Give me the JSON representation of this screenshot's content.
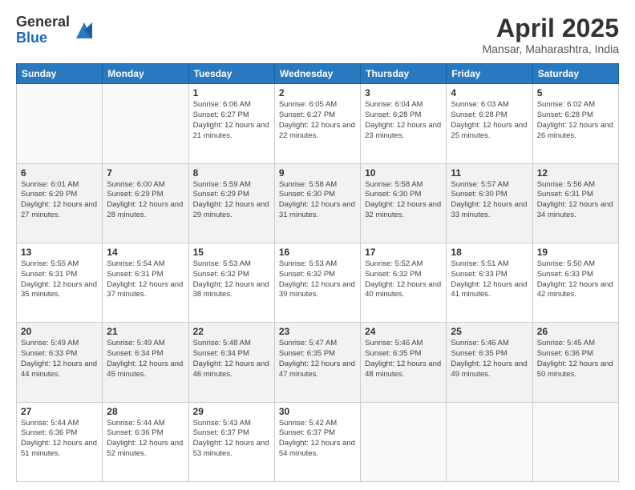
{
  "logo": {
    "general": "General",
    "blue": "Blue"
  },
  "title": "April 2025",
  "location": "Mansar, Maharashtra, India",
  "weekdays": [
    "Sunday",
    "Monday",
    "Tuesday",
    "Wednesday",
    "Thursday",
    "Friday",
    "Saturday"
  ],
  "weeks": [
    [
      {
        "day": "",
        "sunrise": "",
        "sunset": "",
        "daylight": ""
      },
      {
        "day": "",
        "sunrise": "",
        "sunset": "",
        "daylight": ""
      },
      {
        "day": "1",
        "sunrise": "Sunrise: 6:06 AM",
        "sunset": "Sunset: 6:27 PM",
        "daylight": "Daylight: 12 hours and 21 minutes."
      },
      {
        "day": "2",
        "sunrise": "Sunrise: 6:05 AM",
        "sunset": "Sunset: 6:27 PM",
        "daylight": "Daylight: 12 hours and 22 minutes."
      },
      {
        "day": "3",
        "sunrise": "Sunrise: 6:04 AM",
        "sunset": "Sunset: 6:28 PM",
        "daylight": "Daylight: 12 hours and 23 minutes."
      },
      {
        "day": "4",
        "sunrise": "Sunrise: 6:03 AM",
        "sunset": "Sunset: 6:28 PM",
        "daylight": "Daylight: 12 hours and 25 minutes."
      },
      {
        "day": "5",
        "sunrise": "Sunrise: 6:02 AM",
        "sunset": "Sunset: 6:28 PM",
        "daylight": "Daylight: 12 hours and 26 minutes."
      }
    ],
    [
      {
        "day": "6",
        "sunrise": "Sunrise: 6:01 AM",
        "sunset": "Sunset: 6:29 PM",
        "daylight": "Daylight: 12 hours and 27 minutes."
      },
      {
        "day": "7",
        "sunrise": "Sunrise: 6:00 AM",
        "sunset": "Sunset: 6:29 PM",
        "daylight": "Daylight: 12 hours and 28 minutes."
      },
      {
        "day": "8",
        "sunrise": "Sunrise: 5:59 AM",
        "sunset": "Sunset: 6:29 PM",
        "daylight": "Daylight: 12 hours and 29 minutes."
      },
      {
        "day": "9",
        "sunrise": "Sunrise: 5:58 AM",
        "sunset": "Sunset: 6:30 PM",
        "daylight": "Daylight: 12 hours and 31 minutes."
      },
      {
        "day": "10",
        "sunrise": "Sunrise: 5:58 AM",
        "sunset": "Sunset: 6:30 PM",
        "daylight": "Daylight: 12 hours and 32 minutes."
      },
      {
        "day": "11",
        "sunrise": "Sunrise: 5:57 AM",
        "sunset": "Sunset: 6:30 PM",
        "daylight": "Daylight: 12 hours and 33 minutes."
      },
      {
        "day": "12",
        "sunrise": "Sunrise: 5:56 AM",
        "sunset": "Sunset: 6:31 PM",
        "daylight": "Daylight: 12 hours and 34 minutes."
      }
    ],
    [
      {
        "day": "13",
        "sunrise": "Sunrise: 5:55 AM",
        "sunset": "Sunset: 6:31 PM",
        "daylight": "Daylight: 12 hours and 35 minutes."
      },
      {
        "day": "14",
        "sunrise": "Sunrise: 5:54 AM",
        "sunset": "Sunset: 6:31 PM",
        "daylight": "Daylight: 12 hours and 37 minutes."
      },
      {
        "day": "15",
        "sunrise": "Sunrise: 5:53 AM",
        "sunset": "Sunset: 6:32 PM",
        "daylight": "Daylight: 12 hours and 38 minutes."
      },
      {
        "day": "16",
        "sunrise": "Sunrise: 5:53 AM",
        "sunset": "Sunset: 6:32 PM",
        "daylight": "Daylight: 12 hours and 39 minutes."
      },
      {
        "day": "17",
        "sunrise": "Sunrise: 5:52 AM",
        "sunset": "Sunset: 6:32 PM",
        "daylight": "Daylight: 12 hours and 40 minutes."
      },
      {
        "day": "18",
        "sunrise": "Sunrise: 5:51 AM",
        "sunset": "Sunset: 6:33 PM",
        "daylight": "Daylight: 12 hours and 41 minutes."
      },
      {
        "day": "19",
        "sunrise": "Sunrise: 5:50 AM",
        "sunset": "Sunset: 6:33 PM",
        "daylight": "Daylight: 12 hours and 42 minutes."
      }
    ],
    [
      {
        "day": "20",
        "sunrise": "Sunrise: 5:49 AM",
        "sunset": "Sunset: 6:33 PM",
        "daylight": "Daylight: 12 hours and 44 minutes."
      },
      {
        "day": "21",
        "sunrise": "Sunrise: 5:49 AM",
        "sunset": "Sunset: 6:34 PM",
        "daylight": "Daylight: 12 hours and 45 minutes."
      },
      {
        "day": "22",
        "sunrise": "Sunrise: 5:48 AM",
        "sunset": "Sunset: 6:34 PM",
        "daylight": "Daylight: 12 hours and 46 minutes."
      },
      {
        "day": "23",
        "sunrise": "Sunrise: 5:47 AM",
        "sunset": "Sunset: 6:35 PM",
        "daylight": "Daylight: 12 hours and 47 minutes."
      },
      {
        "day": "24",
        "sunrise": "Sunrise: 5:46 AM",
        "sunset": "Sunset: 6:35 PM",
        "daylight": "Daylight: 12 hours and 48 minutes."
      },
      {
        "day": "25",
        "sunrise": "Sunrise: 5:46 AM",
        "sunset": "Sunset: 6:35 PM",
        "daylight": "Daylight: 12 hours and 49 minutes."
      },
      {
        "day": "26",
        "sunrise": "Sunrise: 5:45 AM",
        "sunset": "Sunset: 6:36 PM",
        "daylight": "Daylight: 12 hours and 50 minutes."
      }
    ],
    [
      {
        "day": "27",
        "sunrise": "Sunrise: 5:44 AM",
        "sunset": "Sunset: 6:36 PM",
        "daylight": "Daylight: 12 hours and 51 minutes."
      },
      {
        "day": "28",
        "sunrise": "Sunrise: 5:44 AM",
        "sunset": "Sunset: 6:36 PM",
        "daylight": "Daylight: 12 hours and 52 minutes."
      },
      {
        "day": "29",
        "sunrise": "Sunrise: 5:43 AM",
        "sunset": "Sunset: 6:37 PM",
        "daylight": "Daylight: 12 hours and 53 minutes."
      },
      {
        "day": "30",
        "sunrise": "Sunrise: 5:42 AM",
        "sunset": "Sunset: 6:37 PM",
        "daylight": "Daylight: 12 hours and 54 minutes."
      },
      {
        "day": "",
        "sunrise": "",
        "sunset": "",
        "daylight": ""
      },
      {
        "day": "",
        "sunrise": "",
        "sunset": "",
        "daylight": ""
      },
      {
        "day": "",
        "sunrise": "",
        "sunset": "",
        "daylight": ""
      }
    ]
  ]
}
